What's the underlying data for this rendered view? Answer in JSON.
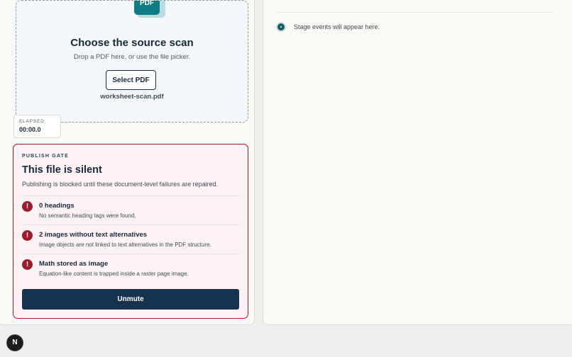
{
  "upload": {
    "icon_label": "PDF",
    "title": "Choose the source scan",
    "subtitle": "Drop a PDF here, or use the file picker.",
    "select_button": "Select PDF",
    "file_name": "worksheet-scan.pdf"
  },
  "timer": {
    "label": "ELAPSED",
    "value": "00:00.0"
  },
  "gate": {
    "eyebrow": "PUBLISH GATE",
    "title": "This file is silent",
    "description": "Publishing is blocked until these document-level failures are repaired.",
    "issues": [
      {
        "title": "0 headings",
        "description": "No semantic heading tags were found."
      },
      {
        "title": "2 images without text alternatives",
        "description": "Image objects are not linked to text alternatives in the PDF structure."
      },
      {
        "title": "Math stored as image",
        "description": "Equation-like content is trapped inside a raster page image."
      }
    ],
    "issue_icon": "!",
    "action_button": "Unmute"
  },
  "timeline": {
    "empty_text": "Stage events will appear here."
  },
  "badge": {
    "letter": "N"
  },
  "colors": {
    "accent_teal": "#117b85",
    "alert_red": "#9b1c2c",
    "primary_navy": "#17324d"
  }
}
